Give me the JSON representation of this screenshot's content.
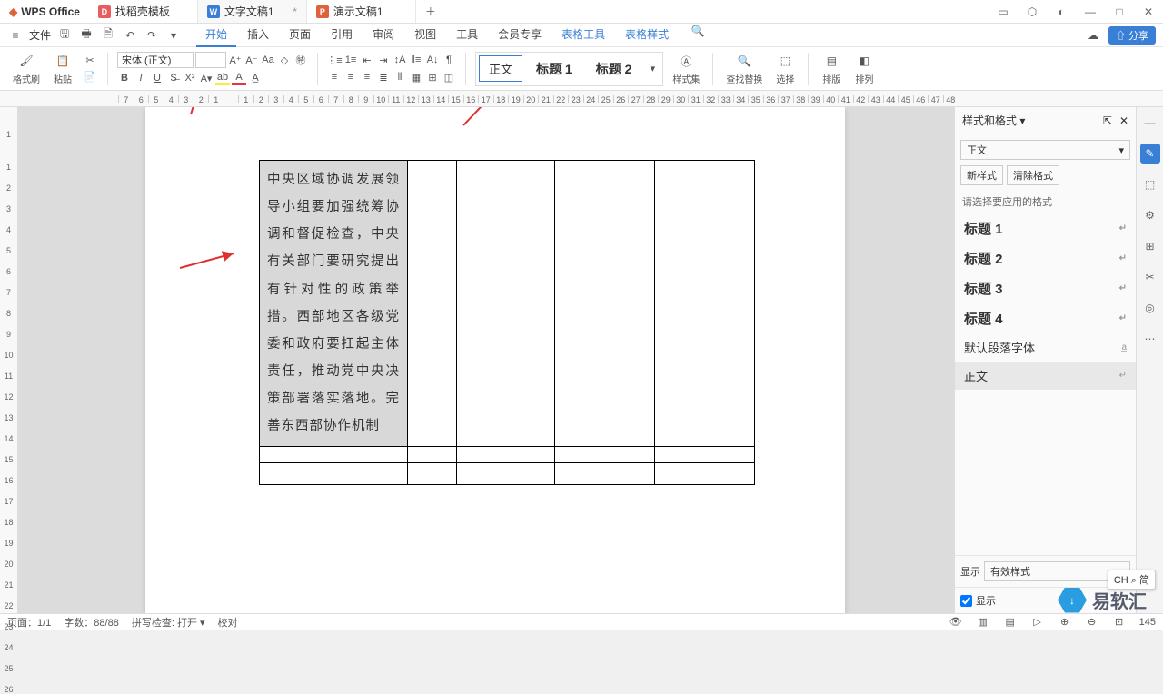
{
  "app_name": "WPS Office",
  "tabs": [
    {
      "label": "找稻壳模板",
      "ico_bg": "#e85d5d",
      "ico_txt": "D"
    },
    {
      "label": "文字文稿1",
      "ico_bg": "#3a7fd6",
      "ico_txt": "W",
      "active": true
    },
    {
      "label": "演示文稿1",
      "ico_bg": "#e0623a",
      "ico_txt": "P"
    }
  ],
  "menu": {
    "file": "文件",
    "items": [
      "开始",
      "插入",
      "页面",
      "引用",
      "审阅",
      "视图",
      "工具",
      "会员专享",
      "表格工具",
      "表格样式"
    ],
    "active": "开始",
    "blue_extra": [
      "表格工具",
      "表格样式"
    ]
  },
  "share_btn": "分享",
  "ribbon": {
    "format_painter": "格式刷",
    "paste": "粘贴",
    "font_name": "宋体 (正文)",
    "font_size": "",
    "style_current": "正文",
    "style_h1": "标题 1",
    "style_h2": "标题 2",
    "style_set": "样式集",
    "find_replace": "查找替换",
    "select": "选择",
    "layout": "排版",
    "order": "排列"
  },
  "ruler_ticks": [
    "7",
    "6",
    "5",
    "4",
    "3",
    "2",
    "1",
    "",
    "1",
    "2",
    "3",
    "4",
    "5",
    "6",
    "7",
    "8",
    "9",
    "10",
    "11",
    "12",
    "13",
    "14",
    "15",
    "16",
    "17",
    "18",
    "19",
    "20",
    "21",
    "22",
    "23",
    "24",
    "25",
    "26",
    "27",
    "28",
    "29",
    "30",
    "31",
    "32",
    "33",
    "34",
    "35",
    "36",
    "37",
    "38",
    "39",
    "40",
    "41",
    "42",
    "43",
    "44",
    "45",
    "46",
    "47",
    "48"
  ],
  "vruler_ticks": [
    "1",
    "",
    "1",
    "2",
    "3",
    "4",
    "5",
    "6",
    "7",
    "8",
    "9",
    "10",
    "11",
    "12",
    "13",
    "14",
    "15",
    "16",
    "17",
    "18",
    "19",
    "20",
    "21",
    "22",
    "23",
    "24",
    "25",
    "26"
  ],
  "cell_text": "中央区域协调发展领导小组要加强统筹协调和督促检查，中央有关部门要研究提出有针对性的政策举措。西部地区各级党委和政府要扛起主体责任，推动党中央决策部署落实落地。完善东西部协作机制",
  "side": {
    "title": "样式和格式",
    "current": "正文",
    "btn_new": "新样式",
    "btn_clear": "清除格式",
    "hint": "请选择要应用的格式",
    "list": [
      {
        "label": "标题 1",
        "h": true
      },
      {
        "label": "标题 2",
        "h": true
      },
      {
        "label": "标题 3",
        "h": true
      },
      {
        "label": "标题 4",
        "h": true
      },
      {
        "label": "默认段落字体"
      },
      {
        "label": "正文",
        "active": true
      }
    ],
    "show": "显示",
    "show_val": "有效样式",
    "show_chk": "显示"
  },
  "status": {
    "page": "页面：1/1",
    "words": "字数：88/88",
    "spell": "拼写检查: 打开",
    "proof": "校对",
    "zoom": "145"
  },
  "ime": "CH ⌕ 简",
  "watermark": "易软汇"
}
